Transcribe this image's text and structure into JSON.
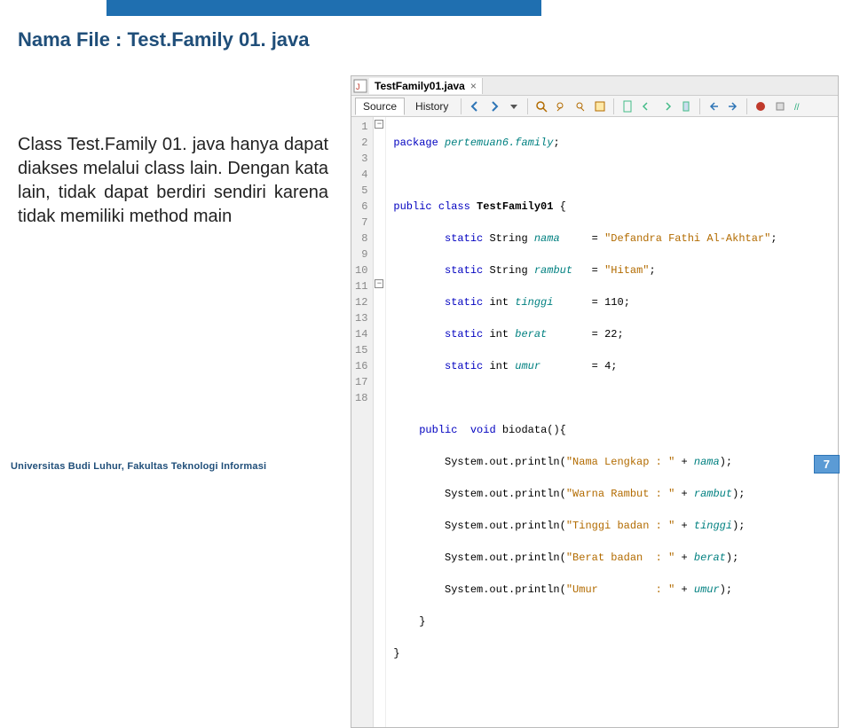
{
  "title": "Nama File : Test.Family 01. java",
  "body_text": "Class Test.Family 01. java hanya dapat diakses melalui class lain. Dengan kata lain, tidak dapat berdiri sendiri karena tidak memiliki method main",
  "footer": "Universitas Budi Luhur, Fakultas Teknologi Informasi",
  "page_number": "7",
  "ide": {
    "tab_label": "TestFamily01.java",
    "subtabs": {
      "source": "Source",
      "history": "History"
    },
    "java": {
      "package_kw": "package",
      "package_name": "pertemuan6.family",
      "public_kw": "public",
      "class_kw": "class",
      "class_name": "TestFamily01",
      "static_kw": "static",
      "string_t": "String",
      "int_t": "int",
      "void_kw": "void",
      "fields": {
        "nama": {
          "name": "nama",
          "value": "\"Defandra Fathi Al-Akhtar\""
        },
        "rambut": {
          "name": "rambut",
          "value": "\"Hitam\""
        },
        "tinggi": {
          "name": "tinggi",
          "value": "110"
        },
        "berat": {
          "name": "berat",
          "value": "22"
        },
        "umur": {
          "name": "umur",
          "value": "4"
        }
      },
      "method_name": "biodata",
      "sysout": "System.out.println",
      "prints": {
        "l1": {
          "label": "\"Nama Lengkap : \"",
          "var": "nama"
        },
        "l2": {
          "label": "\"Warna Rambut : \"",
          "var": "rambut"
        },
        "l3": {
          "label": "\"Tinggi badan : \"",
          "var": "tinggi"
        },
        "l4": {
          "label": "\"Berat badan  : \"",
          "var": "berat"
        },
        "l5": {
          "label": "\"Umur         : \"",
          "var": "umur"
        }
      }
    }
  }
}
